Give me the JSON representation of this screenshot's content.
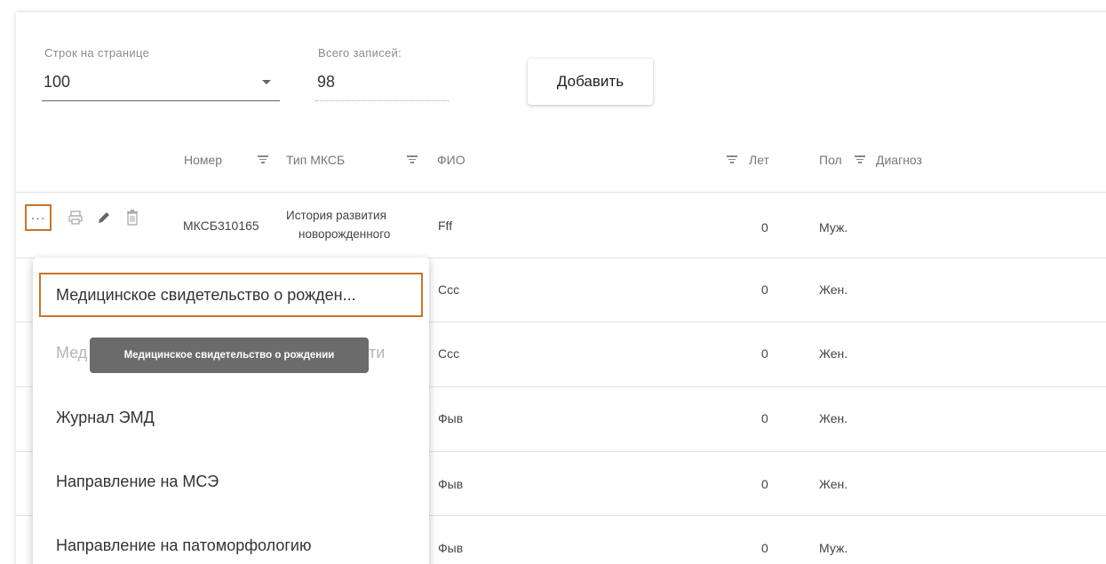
{
  "controls": {
    "rows_label": "Строк на странице",
    "rows_value": "100",
    "total_label": "Всего записей:",
    "total_value": "98",
    "add_button": "Добавить"
  },
  "columns": {
    "number": "Номер",
    "type": "Тип МКСБ",
    "fio": "ФИО",
    "age": "Лет",
    "sex": "Пол",
    "diagnosis": "Диагноз"
  },
  "rows": [
    {
      "number": "МКСБ310165",
      "type_line1": "История развития",
      "type_line2": "новорожденного",
      "fio": "Fff",
      "age": "0",
      "sex": "Муж."
    },
    {
      "fio": "Ccc",
      "age": "0",
      "sex": "Жен."
    },
    {
      "fio": "Ccc",
      "age": "0",
      "sex": "Жен."
    },
    {
      "fio": "Фыв",
      "age": "0",
      "sex": "Жен."
    },
    {
      "fio": "Фыв",
      "age": "0",
      "sex": "Жен."
    },
    {
      "fio": "Фыв",
      "age": "0",
      "sex": "Муж."
    }
  ],
  "menu": {
    "items": [
      "Медицинское свидетельство о рожден...",
      "Мед",
      "Журнал ЭМД",
      "Направление на МСЭ",
      "Направление на патоморфологию"
    ],
    "disabled_suffix": "ти"
  },
  "tooltip": "Медицинское свидетельство о рождении",
  "row_actions": {
    "more": "···",
    "icons": [
      "more-icon",
      "print-icon",
      "edit-icon",
      "delete-icon"
    ]
  },
  "colors": {
    "highlight": "#c8742a",
    "tooltip_bg": "#6b6b6b"
  }
}
